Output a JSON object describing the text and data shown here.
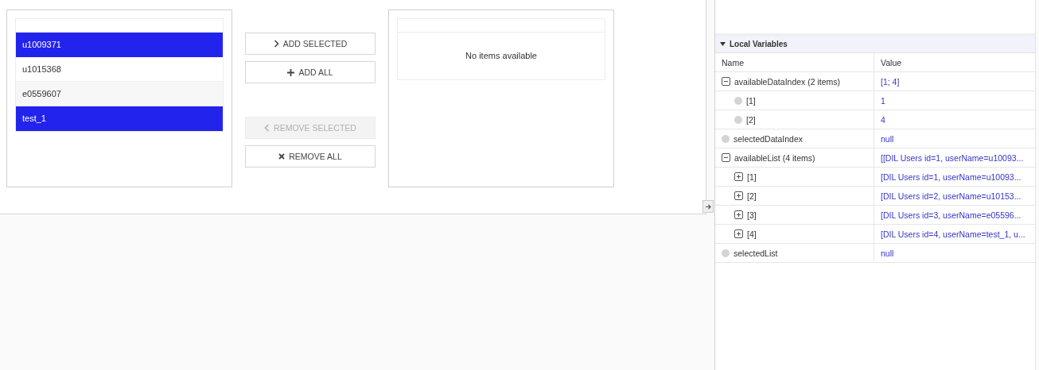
{
  "available_list": {
    "items": [
      {
        "label": "u1009371",
        "selected": true
      },
      {
        "label": "u1015368",
        "selected": false
      },
      {
        "label": "e0559607",
        "selected": false
      },
      {
        "label": "test_1",
        "selected": true
      }
    ]
  },
  "buttons": [
    {
      "kind": "add-selected",
      "label": "ADD SELECTED",
      "disabled": false
    },
    {
      "kind": "add-all",
      "label": "ADD ALL",
      "disabled": false
    },
    {
      "kind": "remove-selected",
      "label": "REMOVE SELECTED",
      "disabled": true
    },
    {
      "kind": "remove-all",
      "label": "REMOVE ALL",
      "disabled": false
    }
  ],
  "selected_list": {
    "empty_message": "No items available"
  },
  "local_variables": {
    "title": "Local Variables",
    "expanded": true,
    "columns": [
      "Name",
      "Value"
    ],
    "rows": [
      {
        "name": "availableDataIndex (2 items)",
        "value": "[1; 4]",
        "kind": "group",
        "expanded": true,
        "children": [
          {
            "name": "[1]",
            "value": "1",
            "kind": "leaf"
          },
          {
            "name": "[2]",
            "value": "4",
            "kind": "leaf"
          }
        ]
      },
      {
        "name": "selectedDataIndex",
        "value": "null",
        "kind": "leaf"
      },
      {
        "name": "availableList (4 items)",
        "value": "[[DIL Users id=1, userName=u10093...",
        "kind": "group",
        "expanded": true,
        "children": [
          {
            "name": "[1]",
            "value": "[DIL Users id=1, userName=u10093...",
            "kind": "group",
            "expanded": false
          },
          {
            "name": "[2]",
            "value": "[DIL Users id=2, userName=u10153...",
            "kind": "group",
            "expanded": false
          },
          {
            "name": "[3]",
            "value": "[DIL Users id=3, userName=e05596...",
            "kind": "group",
            "expanded": false
          },
          {
            "name": "[4]",
            "value": "[DIL Users id=4, userName=test_1, u...",
            "kind": "group",
            "expanded": false
          }
        ]
      },
      {
        "name": "selectedList",
        "value": "null",
        "kind": "leaf"
      }
    ]
  }
}
